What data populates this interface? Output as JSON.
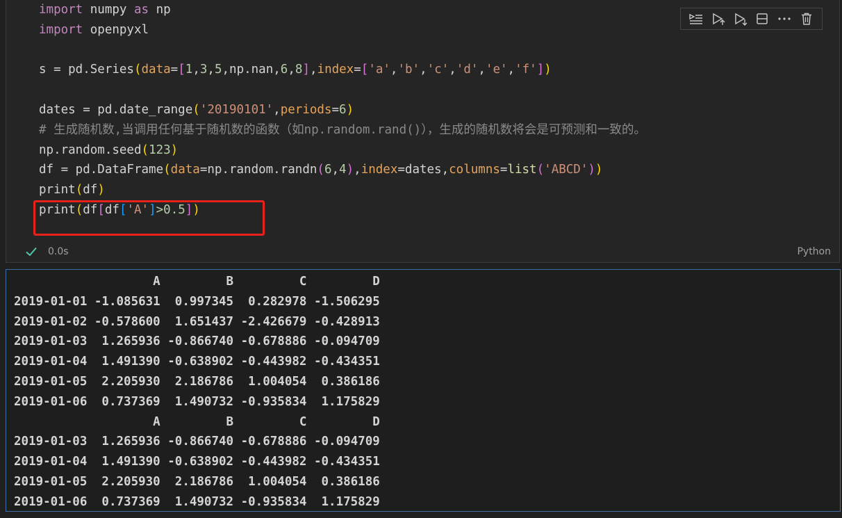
{
  "code_cell": {
    "lines": [
      "import numpy as np",
      "import openpyxl",
      "",
      "s = pd.Series(data=[1,3,5,np.nan,6,8],index=['a','b','c','d','e','f'])",
      "",
      "dates = pd.date_range('20190101',periods=6)",
      "# 生成随机数,当调用任何基于随机数的函数（如np.random.rand()），生成的随机数将会是可预测和一致的。",
      "np.random.seed(123)",
      "df = pd.DataFrame(data=np.random.randn(6,4),index=dates,columns=list('ABCD'))",
      "print(df)",
      "print(df[df['A']>0.5])"
    ],
    "toolbar": [
      {
        "name": "run-by-line-icon",
        "label": "Run by line"
      },
      {
        "name": "execute-above-icon",
        "label": "Execute above"
      },
      {
        "name": "execute-below-icon",
        "label": "Execute below"
      },
      {
        "name": "split-cell-icon",
        "label": "Split cell"
      },
      {
        "name": "more-actions-icon",
        "label": "More actions"
      },
      {
        "name": "delete-icon",
        "label": "Delete"
      }
    ],
    "status": {
      "check_icon": "checkmark-icon",
      "time": "0.0s",
      "language": "Python"
    }
  },
  "output": {
    "lines": [
      "                   A         B         C         D",
      "2019-01-01 -1.085631  0.997345  0.282978 -1.506295",
      "2019-01-02 -0.578600  1.651437 -2.426679 -0.428913",
      "2019-01-03  1.265936 -0.866740 -0.678886 -0.094709",
      "2019-01-04  1.491390 -0.638902 -0.443982 -0.434351",
      "2019-01-05  2.205930  2.186786  1.004054  0.386186",
      "2019-01-06  0.737369  1.490732 -0.935834  1.175829",
      "                   A         B         C         D",
      "2019-01-03  1.265936 -0.866740 -0.678886 -0.094709",
      "2019-01-04  1.491390 -0.638902 -0.443982 -0.434351",
      "2019-01-05  2.205930  2.186786  1.004054  0.386186",
      "2019-01-06  0.737369  1.490732 -0.935834  1.175829"
    ]
  },
  "colors": {
    "highlight_box": "#e8221b",
    "output_border": "#3f6fab",
    "success_check": "#4ec9b0"
  }
}
